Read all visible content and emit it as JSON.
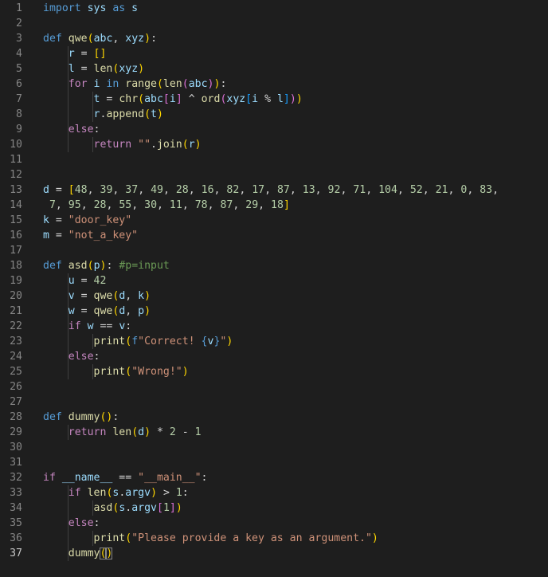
{
  "editor": {
    "language": "python",
    "active_line": 37,
    "colors": {
      "background": "#1e1e1e",
      "line_number": "#858585",
      "active_line_number": "#c6c6c6",
      "keyword": "#569cd6",
      "control_keyword": "#c586c0",
      "function": "#dcdcaa",
      "variable": "#9cdcfe",
      "number": "#b5cea8",
      "string": "#ce9178",
      "comment": "#6a9955"
    },
    "lines": [
      {
        "n": "1",
        "tokens": [
          [
            "kw",
            "import"
          ],
          [
            "var",
            " sys"
          ],
          [
            "kw",
            " as"
          ],
          [
            "var",
            " s"
          ]
        ]
      },
      {
        "n": "2",
        "tokens": []
      },
      {
        "n": "3",
        "tokens": [
          [
            "kw",
            "def"
          ],
          [
            "p",
            " "
          ],
          [
            "fn",
            "qwe"
          ],
          [
            "b1",
            "("
          ],
          [
            "var",
            "abc"
          ],
          [
            "p",
            ", "
          ],
          [
            "var",
            "xyz"
          ],
          [
            "b1",
            ")"
          ],
          [
            "p",
            ":"
          ]
        ]
      },
      {
        "n": "4",
        "tokens": [
          [
            "p",
            "    "
          ],
          [
            "var",
            "r"
          ],
          [
            "p",
            " = "
          ],
          [
            "b1",
            "[]"
          ]
        ]
      },
      {
        "n": "5",
        "tokens": [
          [
            "p",
            "    "
          ],
          [
            "var",
            "l"
          ],
          [
            "p",
            " = "
          ],
          [
            "fn",
            "len"
          ],
          [
            "b1",
            "("
          ],
          [
            "var",
            "xyz"
          ],
          [
            "b1",
            ")"
          ]
        ]
      },
      {
        "n": "6",
        "tokens": [
          [
            "p",
            "    "
          ],
          [
            "ctl",
            "for"
          ],
          [
            "var",
            " i"
          ],
          [
            "kw",
            " in"
          ],
          [
            "p",
            " "
          ],
          [
            "fn",
            "range"
          ],
          [
            "b1",
            "("
          ],
          [
            "fn",
            "len"
          ],
          [
            "b2",
            "("
          ],
          [
            "var",
            "abc"
          ],
          [
            "b2",
            ")"
          ],
          [
            "b1",
            ")"
          ],
          [
            "p",
            ":"
          ]
        ]
      },
      {
        "n": "7",
        "tokens": [
          [
            "p",
            "        "
          ],
          [
            "var",
            "t"
          ],
          [
            "p",
            " = "
          ],
          [
            "fn",
            "chr"
          ],
          [
            "b1",
            "("
          ],
          [
            "var",
            "abc"
          ],
          [
            "b2",
            "["
          ],
          [
            "var",
            "i"
          ],
          [
            "b2",
            "]"
          ],
          [
            "p",
            " ^ "
          ],
          [
            "fn",
            "ord"
          ],
          [
            "b2",
            "("
          ],
          [
            "var",
            "xyz"
          ],
          [
            "b3",
            "["
          ],
          [
            "var",
            "i"
          ],
          [
            "p",
            " % "
          ],
          [
            "var",
            "l"
          ],
          [
            "b3",
            "]"
          ],
          [
            "b2",
            ")"
          ],
          [
            "b1",
            ")"
          ]
        ]
      },
      {
        "n": "8",
        "tokens": [
          [
            "p",
            "        "
          ],
          [
            "var",
            "r"
          ],
          [
            "p",
            "."
          ],
          [
            "fn",
            "append"
          ],
          [
            "b1",
            "("
          ],
          [
            "var",
            "t"
          ],
          [
            "b1",
            ")"
          ]
        ]
      },
      {
        "n": "9",
        "tokens": [
          [
            "p",
            "    "
          ],
          [
            "ctl",
            "else"
          ],
          [
            "p",
            ":"
          ]
        ]
      },
      {
        "n": "10",
        "tokens": [
          [
            "p",
            "        "
          ],
          [
            "ctl",
            "return"
          ],
          [
            "p",
            " "
          ],
          [
            "str",
            "\"\""
          ],
          [
            "p",
            "."
          ],
          [
            "fn",
            "join"
          ],
          [
            "b1",
            "("
          ],
          [
            "var",
            "r"
          ],
          [
            "b1",
            ")"
          ]
        ]
      },
      {
        "n": "11",
        "tokens": []
      },
      {
        "n": "12",
        "tokens": []
      },
      {
        "n": "13",
        "tokens": [
          [
            "var",
            "d"
          ],
          [
            "p",
            " = "
          ],
          [
            "b1",
            "["
          ],
          [
            "num",
            "48"
          ],
          [
            "p",
            ", "
          ],
          [
            "num",
            "39"
          ],
          [
            "p",
            ", "
          ],
          [
            "num",
            "37"
          ],
          [
            "p",
            ", "
          ],
          [
            "num",
            "49"
          ],
          [
            "p",
            ", "
          ],
          [
            "num",
            "28"
          ],
          [
            "p",
            ", "
          ],
          [
            "num",
            "16"
          ],
          [
            "p",
            ", "
          ],
          [
            "num",
            "82"
          ],
          [
            "p",
            ", "
          ],
          [
            "num",
            "17"
          ],
          [
            "p",
            ", "
          ],
          [
            "num",
            "87"
          ],
          [
            "p",
            ", "
          ],
          [
            "num",
            "13"
          ],
          [
            "p",
            ", "
          ],
          [
            "num",
            "92"
          ],
          [
            "p",
            ", "
          ],
          [
            "num",
            "71"
          ],
          [
            "p",
            ", "
          ],
          [
            "num",
            "104"
          ],
          [
            "p",
            ", "
          ],
          [
            "num",
            "52"
          ],
          [
            "p",
            ", "
          ],
          [
            "num",
            "21"
          ],
          [
            "p",
            ", "
          ],
          [
            "num",
            "0"
          ],
          [
            "p",
            ", "
          ],
          [
            "num",
            "83"
          ],
          [
            "p",
            ","
          ]
        ]
      },
      {
        "n": "14",
        "tokens": [
          [
            "p",
            " "
          ],
          [
            "num",
            "7"
          ],
          [
            "p",
            ", "
          ],
          [
            "num",
            "95"
          ],
          [
            "p",
            ", "
          ],
          [
            "num",
            "28"
          ],
          [
            "p",
            ", "
          ],
          [
            "num",
            "55"
          ],
          [
            "p",
            ", "
          ],
          [
            "num",
            "30"
          ],
          [
            "p",
            ", "
          ],
          [
            "num",
            "11"
          ],
          [
            "p",
            ", "
          ],
          [
            "num",
            "78"
          ],
          [
            "p",
            ", "
          ],
          [
            "num",
            "87"
          ],
          [
            "p",
            ", "
          ],
          [
            "num",
            "29"
          ],
          [
            "p",
            ", "
          ],
          [
            "num",
            "18"
          ],
          [
            "b1",
            "]"
          ]
        ]
      },
      {
        "n": "15",
        "tokens": [
          [
            "var",
            "k"
          ],
          [
            "p",
            " = "
          ],
          [
            "str",
            "\"door_key\""
          ]
        ]
      },
      {
        "n": "16",
        "tokens": [
          [
            "var",
            "m"
          ],
          [
            "p",
            " = "
          ],
          [
            "str",
            "\"not_a_key\""
          ]
        ]
      },
      {
        "n": "17",
        "tokens": []
      },
      {
        "n": "18",
        "tokens": [
          [
            "kw",
            "def"
          ],
          [
            "p",
            " "
          ],
          [
            "fn",
            "asd"
          ],
          [
            "b1",
            "("
          ],
          [
            "var",
            "p"
          ],
          [
            "b1",
            ")"
          ],
          [
            "p",
            ": "
          ],
          [
            "cm",
            "#p=input"
          ]
        ]
      },
      {
        "n": "19",
        "tokens": [
          [
            "p",
            "    "
          ],
          [
            "var",
            "u"
          ],
          [
            "p",
            " = "
          ],
          [
            "num",
            "42"
          ]
        ]
      },
      {
        "n": "20",
        "tokens": [
          [
            "p",
            "    "
          ],
          [
            "var",
            "v"
          ],
          [
            "p",
            " = "
          ],
          [
            "fn",
            "qwe"
          ],
          [
            "b1",
            "("
          ],
          [
            "var",
            "d"
          ],
          [
            "p",
            ", "
          ],
          [
            "var",
            "k"
          ],
          [
            "b1",
            ")"
          ]
        ]
      },
      {
        "n": "21",
        "tokens": [
          [
            "p",
            "    "
          ],
          [
            "var",
            "w"
          ],
          [
            "p",
            " = "
          ],
          [
            "fn",
            "qwe"
          ],
          [
            "b1",
            "("
          ],
          [
            "var",
            "d"
          ],
          [
            "p",
            ", "
          ],
          [
            "var",
            "p"
          ],
          [
            "b1",
            ")"
          ]
        ]
      },
      {
        "n": "22",
        "tokens": [
          [
            "p",
            "    "
          ],
          [
            "ctl",
            "if"
          ],
          [
            "var",
            " w"
          ],
          [
            "p",
            " == "
          ],
          [
            "var",
            "v"
          ],
          [
            "p",
            ":"
          ]
        ]
      },
      {
        "n": "23",
        "tokens": [
          [
            "p",
            "        "
          ],
          [
            "fn",
            "print"
          ],
          [
            "b1",
            "("
          ],
          [
            "kw",
            "f"
          ],
          [
            "str",
            "\"Correct! "
          ],
          [
            "kw",
            "{"
          ],
          [
            "var",
            "v"
          ],
          [
            "kw",
            "}"
          ],
          [
            "str",
            "\""
          ],
          [
            "b1",
            ")"
          ]
        ]
      },
      {
        "n": "24",
        "tokens": [
          [
            "p",
            "    "
          ],
          [
            "ctl",
            "else"
          ],
          [
            "p",
            ":"
          ]
        ]
      },
      {
        "n": "25",
        "tokens": [
          [
            "p",
            "        "
          ],
          [
            "fn",
            "print"
          ],
          [
            "b1",
            "("
          ],
          [
            "str",
            "\"Wrong!\""
          ],
          [
            "b1",
            ")"
          ]
        ]
      },
      {
        "n": "26",
        "tokens": []
      },
      {
        "n": "27",
        "tokens": []
      },
      {
        "n": "28",
        "tokens": [
          [
            "kw",
            "def"
          ],
          [
            "p",
            " "
          ],
          [
            "fn",
            "dummy"
          ],
          [
            "b1",
            "()"
          ],
          [
            "p",
            ":"
          ]
        ]
      },
      {
        "n": "29",
        "tokens": [
          [
            "p",
            "    "
          ],
          [
            "ctl",
            "return"
          ],
          [
            "p",
            " "
          ],
          [
            "fn",
            "len"
          ],
          [
            "b1",
            "("
          ],
          [
            "var",
            "d"
          ],
          [
            "b1",
            ")"
          ],
          [
            "p",
            " * "
          ],
          [
            "num",
            "2"
          ],
          [
            "p",
            " - "
          ],
          [
            "num",
            "1"
          ]
        ]
      },
      {
        "n": "30",
        "tokens": []
      },
      {
        "n": "31",
        "tokens": []
      },
      {
        "n": "32",
        "tokens": [
          [
            "ctl",
            "if"
          ],
          [
            "var",
            " __name__"
          ],
          [
            "p",
            " == "
          ],
          [
            "str",
            "\"__main__\""
          ],
          [
            "p",
            ":"
          ]
        ]
      },
      {
        "n": "33",
        "tokens": [
          [
            "p",
            "    "
          ],
          [
            "ctl",
            "if"
          ],
          [
            "p",
            " "
          ],
          [
            "fn",
            "len"
          ],
          [
            "b1",
            "("
          ],
          [
            "var",
            "s"
          ],
          [
            "p",
            "."
          ],
          [
            "var",
            "argv"
          ],
          [
            "b1",
            ")"
          ],
          [
            "p",
            " > "
          ],
          [
            "num",
            "1"
          ],
          [
            "p",
            ":"
          ]
        ]
      },
      {
        "n": "34",
        "tokens": [
          [
            "p",
            "        "
          ],
          [
            "fn",
            "asd"
          ],
          [
            "b1",
            "("
          ],
          [
            "var",
            "s"
          ],
          [
            "p",
            "."
          ],
          [
            "var",
            "argv"
          ],
          [
            "b2",
            "["
          ],
          [
            "num",
            "1"
          ],
          [
            "b2",
            "]"
          ],
          [
            "b1",
            ")"
          ]
        ]
      },
      {
        "n": "35",
        "tokens": [
          [
            "p",
            "    "
          ],
          [
            "ctl",
            "else"
          ],
          [
            "p",
            ":"
          ]
        ]
      },
      {
        "n": "36",
        "tokens": [
          [
            "p",
            "        "
          ],
          [
            "fn",
            "print"
          ],
          [
            "b1",
            "("
          ],
          [
            "str",
            "\"Please provide a key as an argument.\""
          ],
          [
            "b1",
            ")"
          ]
        ]
      },
      {
        "n": "37",
        "tokens": [
          [
            "p",
            "    "
          ],
          [
            "fn",
            "dummy"
          ],
          [
            "b1m",
            "("
          ],
          [
            "b1m",
            ")"
          ]
        ]
      }
    ]
  }
}
